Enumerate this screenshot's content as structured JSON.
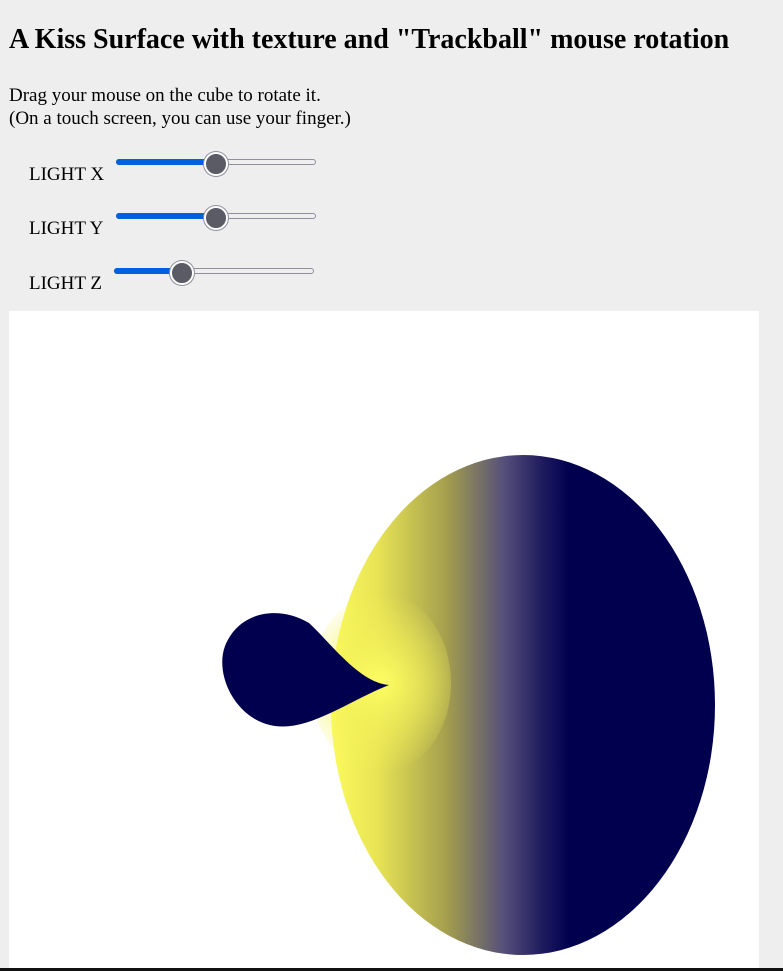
{
  "page": {
    "title": "A Kiss Surface with texture and \"Trackball\" mouse rotation",
    "instructions": [
      "Drag your mouse on the cube to rotate it.",
      "(On a touch screen, you can use your finger.)"
    ]
  },
  "controls": [
    {
      "label": "LIGHT X",
      "value_fraction": 0.5
    },
    {
      "label": "LIGHT Y",
      "value_fraction": 0.5
    },
    {
      "label": "LIGHT Z",
      "value_fraction": 0.32
    }
  ],
  "colors": {
    "background": "#eeeeee",
    "canvas": "#ffffff",
    "surface_lit": "#fbfb5c",
    "surface_dark": "#00004f",
    "slider_fill": "#0060df",
    "slider_thumb": "#5b5b66"
  }
}
